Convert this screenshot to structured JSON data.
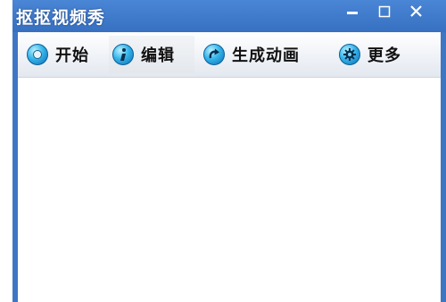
{
  "window": {
    "title": "抠抠视频秀"
  },
  "controls": {
    "minimize_icon": "minimize-icon",
    "maximize_icon": "maximize-icon",
    "close_icon": "close-icon"
  },
  "toolbar": {
    "items": [
      {
        "label": "开始",
        "icon": "record-icon"
      },
      {
        "label": "编辑",
        "icon": "info-icon",
        "active": true
      },
      {
        "label": "生成动画",
        "icon": "redo-arrow-icon"
      },
      {
        "label": "更多",
        "icon": "gear-icon"
      }
    ]
  },
  "colors": {
    "titlebar": "#3f76c4",
    "icon_blue": "#35b4ea",
    "content_bg": "#ffffff"
  }
}
